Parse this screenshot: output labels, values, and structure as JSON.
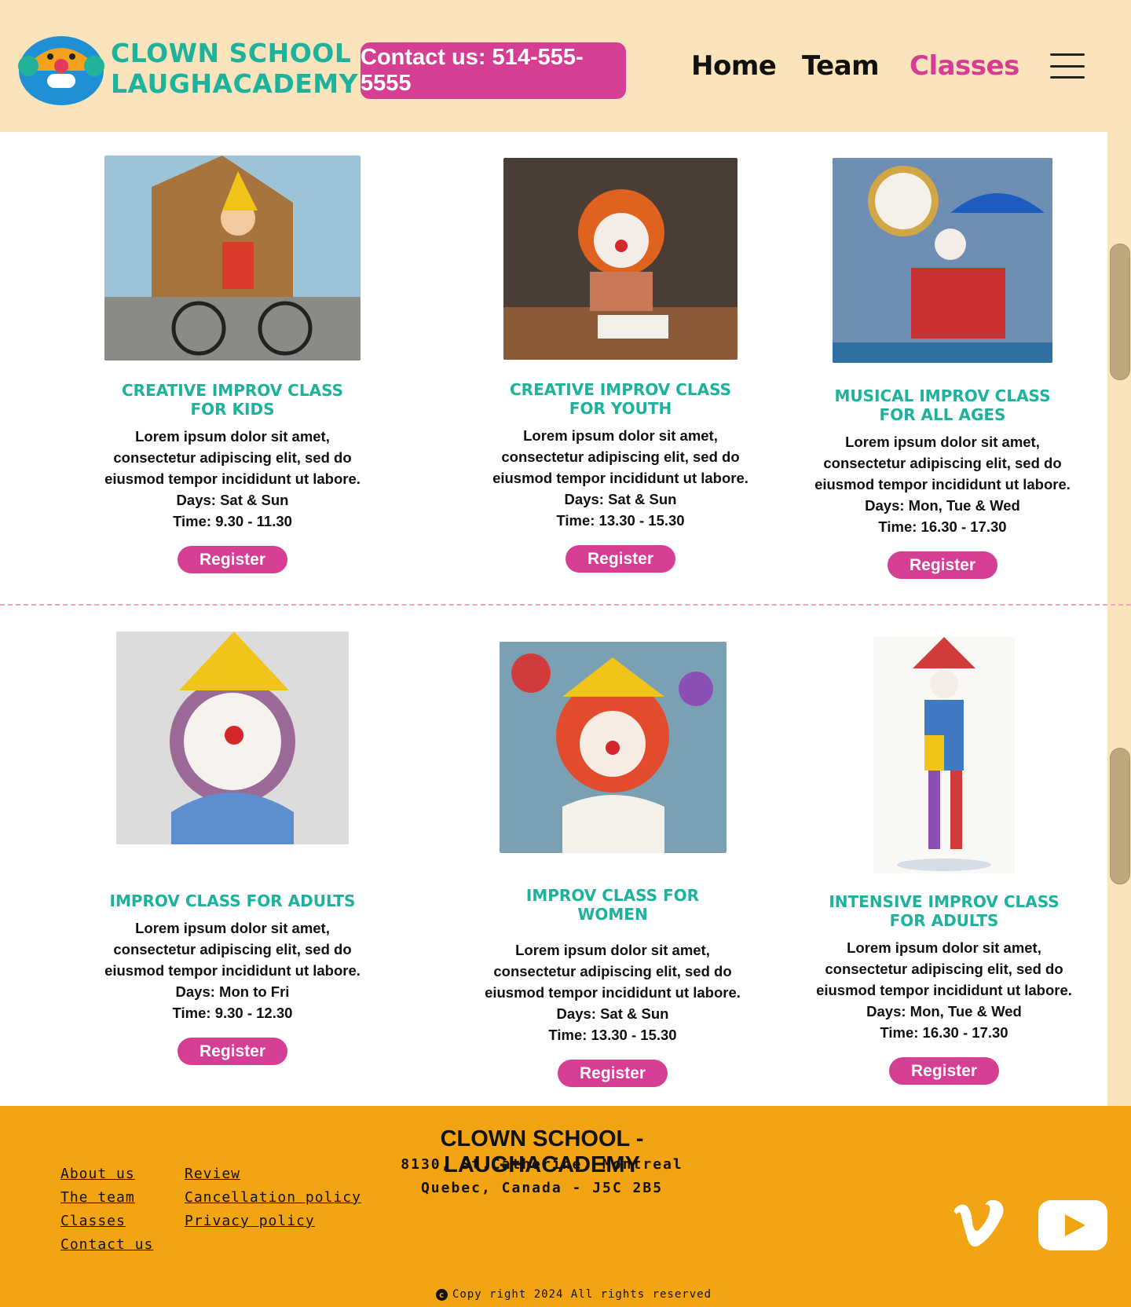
{
  "header": {
    "logo_line1": "CLOWN SCHOOL",
    "logo_line2": "LAUGHACADEMY",
    "contact": "Contact us: 514-555-5555",
    "nav": [
      "Home",
      "Team",
      "Classes"
    ]
  },
  "classes": [
    {
      "title": "Creative improv class for kids",
      "desc": "Lorem ipsum dolor sit amet, consectetur adipiscing elit, sed do eiusmod tempor incididunt ut labore.",
      "days": "Days: Sat & Sun",
      "time": "Time: 9.30 - 11.30",
      "button": "Register"
    },
    {
      "title": "Creative improv class for youth",
      "desc": "Lorem ipsum dolor sit amet, consectetur adipiscing elit, sed do eiusmod tempor incididunt ut labore.",
      "days": "Days: Sat & Sun",
      "time": "Time: 13.30 - 15.30",
      "button": "Register"
    },
    {
      "title": "Musical improv class for all ages",
      "desc": "Lorem ipsum dolor sit amet, consectetur adipiscing elit, sed do eiusmod tempor incididunt ut labore.",
      "days": "Days: Mon, Tue & Wed",
      "time": "Time: 16.30 - 17.30",
      "button": "Register"
    },
    {
      "title": "Improv class for adults",
      "desc": "Lorem ipsum dolor sit amet, consectetur adipiscing elit, sed do eiusmod tempor incididunt ut labore.",
      "days": "Days: Mon to Fri",
      "time": "Time: 9.30 - 12.30",
      "button": "Register"
    },
    {
      "title": "Improv class for women",
      "desc": "Lorem ipsum dolor sit amet, consectetur adipiscing elit, sed do eiusmod tempor incididunt ut labore.",
      "days": "Days: Sat & Sun",
      "time": "Time: 13.30 - 15.30",
      "button": "Register"
    },
    {
      "title": "Intensive improv class for adults",
      "desc": "Lorem ipsum dolor sit amet, consectetur adipiscing elit, sed do eiusmod tempor incididunt ut labore.",
      "days": "Days: Mon, Tue & Wed",
      "time": "Time: 16.30 - 17.30",
      "button": "Register"
    }
  ],
  "footer": {
    "links_col1": [
      "About us",
      "The team",
      "Classes",
      "Contact us"
    ],
    "links_col2": [
      "Review",
      "Cancellation policy",
      "Privacy policy"
    ],
    "title": "CLOWN SCHOOL - LAUGHACADEMY",
    "address1": "8130, St.Catherine, Montreal",
    "address2": "Quebec, Canada - J5C 2B5",
    "copyright": "Copy right 2024 All rights reserved",
    "social_icons": [
      "vimeo-icon",
      "youtube-icon"
    ]
  },
  "colors": {
    "accent": "#d63e94",
    "teal": "#1cb29c",
    "header_bg": "#fbe3bb",
    "footer_bg": "#f2a412"
  }
}
